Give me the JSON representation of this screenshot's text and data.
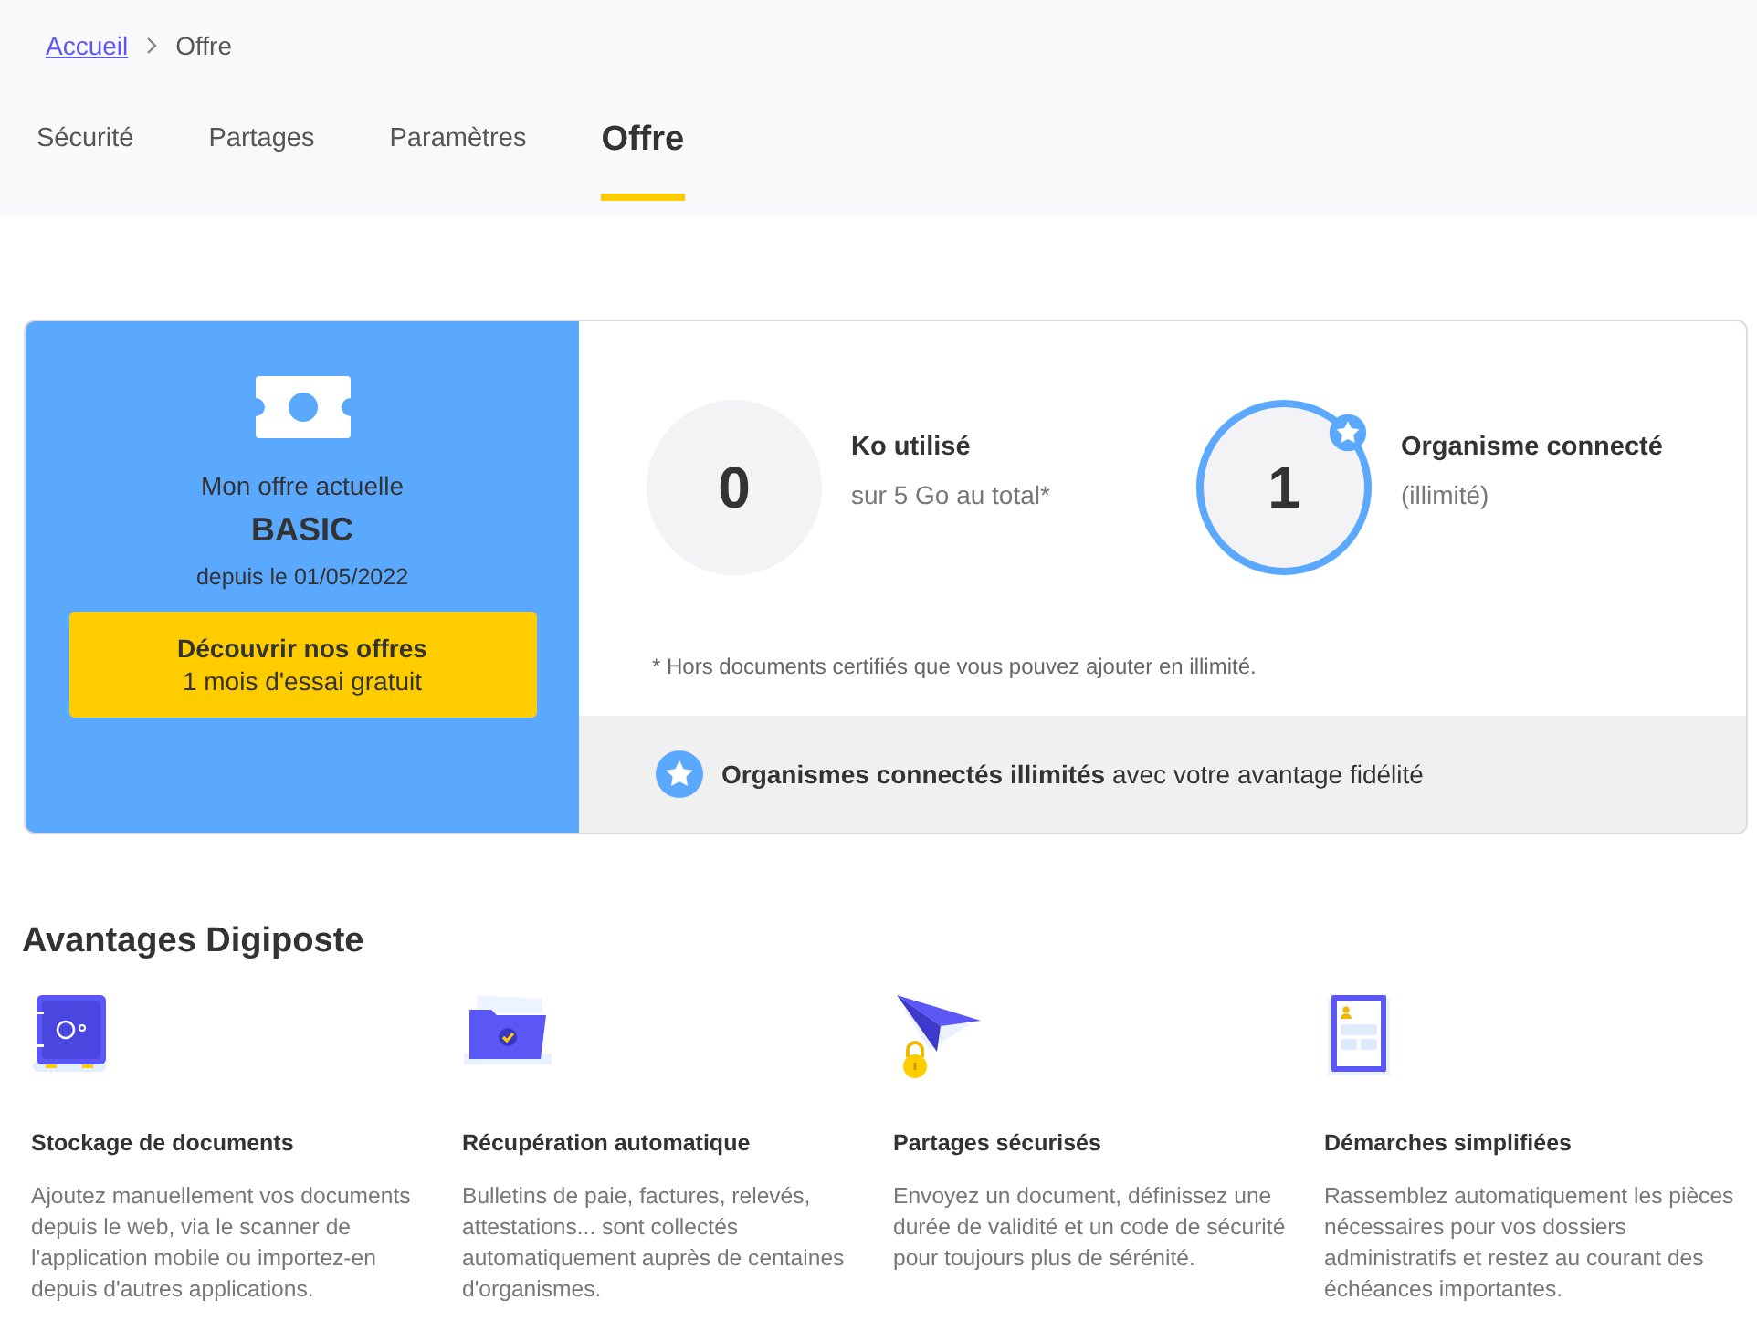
{
  "breadcrumb": [
    {
      "label": "Accueil",
      "link": true
    },
    {
      "label": "Offre",
      "link": false
    }
  ],
  "tabs": [
    {
      "label": "Sécurité",
      "selected": false
    },
    {
      "label": "Partages",
      "selected": false
    },
    {
      "label": "Paramètres",
      "selected": false
    },
    {
      "label": "Offre",
      "selected": true
    }
  ],
  "plan": {
    "caption": "Mon offre actuelle",
    "name": "BASIC",
    "since": "depuis le 01/05/2022",
    "button": {
      "title": "Découvrir nos offres",
      "subtitle": "1 mois d'essai gratuit"
    }
  },
  "stats": [
    {
      "value": "0",
      "label": "Ko utilisé",
      "detail": "sur 5 Go au total*",
      "highlighted": false
    },
    {
      "value": "1",
      "label": "Organisme connecté",
      "detail": "(illimité)",
      "highlighted": true
    }
  ],
  "footnote": "* Hors documents certifiés que vous pouvez ajouter en illimité.",
  "banner": "**Organismes connectés illimités** avec votre avantage fidélité",
  "advantages": {
    "title": "Avantages Digiposte",
    "items": [
      {
        "title": "Stockage de documents",
        "text": "Ajoutez manuellement vos documents depuis le web, via le scanner de l'application mobile ou importez-en depuis d'autres applications."
      },
      {
        "title": "Récupération automatique",
        "text": "Bulletins de paie, factures, relevés, attestations... sont collectés automatiquement auprès de centaines d'organismes."
      },
      {
        "title": "Partages sécurisés",
        "text": "Envoyez un document, définissez une durée de validité et un code de sécurité pour toujours plus de sérénité."
      },
      {
        "title": "Démarches simplifiées",
        "text": "Rassemblez automatiquement les pièces nécessaires pour vos dossiers administratifs et restez au courant des échéances importantes."
      }
    ]
  }
}
